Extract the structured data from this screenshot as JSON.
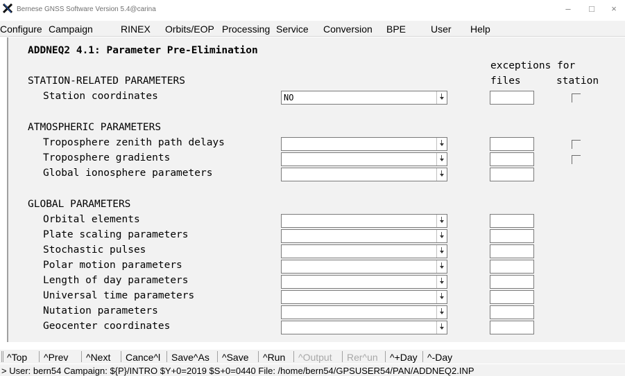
{
  "window": {
    "title": "Bernese GNSS Software Version 5.4@carina",
    "minimize": "–",
    "maximize": "□",
    "close": "×"
  },
  "menu": [
    "Configure",
    "Campaign",
    "RINEX",
    "Orbits/EOP",
    "Processing",
    "Service",
    "Conversion",
    "BPE",
    "User",
    "Help"
  ],
  "panel": {
    "title": "ADDNEQ2 4.1: Parameter Pre-Elimination",
    "exceptions_header": "exceptions for",
    "col_files": "files",
    "col_station": "station",
    "sections": {
      "station": "STATION-RELATED PARAMETERS",
      "atmospheric": "ATMOSPHERIC PARAMETERS",
      "global": "GLOBAL PARAMETERS"
    },
    "params": {
      "station_coordinates": {
        "label": "Station coordinates",
        "value": "NO"
      },
      "tropo_zenith": {
        "label": "Troposphere zenith path delays",
        "value": ""
      },
      "tropo_gradients": {
        "label": "Troposphere gradients",
        "value": ""
      },
      "global_iono": {
        "label": "Global ionosphere parameters",
        "value": ""
      },
      "orbital": {
        "label": "Orbital elements",
        "value": ""
      },
      "plate_scaling": {
        "label": "Plate scaling parameters",
        "value": ""
      },
      "stochastic": {
        "label": "Stochastic pulses",
        "value": ""
      },
      "polar_motion": {
        "label": "Polar motion parameters",
        "value": ""
      },
      "lod": {
        "label": "Length of day parameters",
        "value": ""
      },
      "ut": {
        "label": "Universal time parameters",
        "value": ""
      },
      "nutation": {
        "label": "Nutation parameters",
        "value": ""
      },
      "geocenter": {
        "label": "Geocenter coordinates",
        "value": ""
      }
    }
  },
  "buttons": {
    "top": "^Top",
    "prev": "^Prev",
    "next": "^Next",
    "cancel": "Cance^l",
    "save_as": "Save^As",
    "save": "^Save",
    "run": "^Run",
    "output": "^Output",
    "rerun": "Rer^un",
    "plus_day": "^+Day",
    "minus_day": "^-Day"
  },
  "status": "> User: bern54  Campaign: ${P}/INTRO  $Y+0=2019  $S+0=0440  File: /home/bern54/GPSUSER54/PAN/ADDNEQ2.INP"
}
